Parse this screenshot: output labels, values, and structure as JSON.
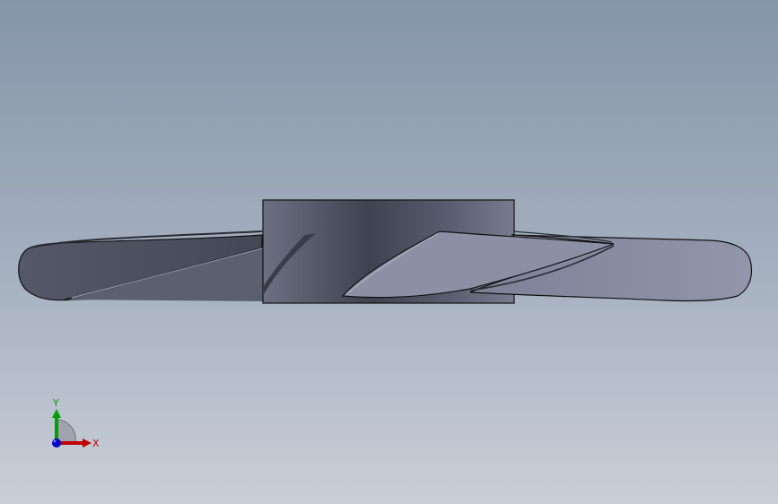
{
  "viewport": {
    "background_top": "#8595a9",
    "background_bottom": "#c9cfd8"
  },
  "model": {
    "name": "propeller",
    "hub_color": "#55596a",
    "blade_dark_color": "#4a4e5d",
    "blade_light_color": "#8d91a6"
  },
  "triad": {
    "x_label": "X",
    "y_label": "Y",
    "x_color": "#c00000",
    "y_color": "#00a000",
    "z_color": "#0000c0"
  }
}
